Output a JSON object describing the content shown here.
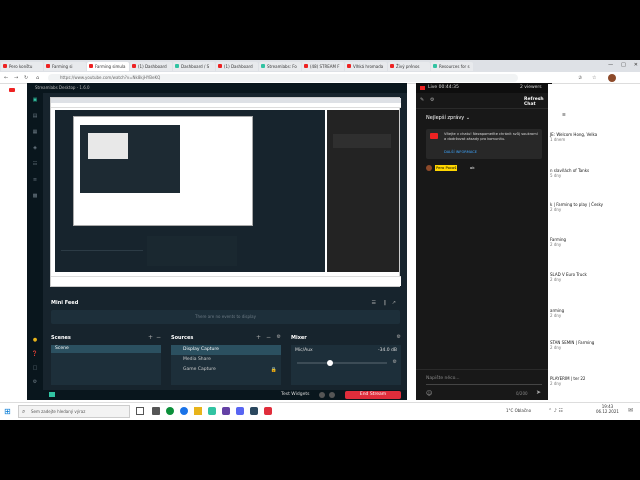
{
  "browser": {
    "tabs": [
      "Pero kon&#x161;tu",
      "Farming si",
      "Farming simula",
      "(1) Dashboard",
      "Dashboard / S",
      "(1) Dashboard",
      "Streamlabs: Fo",
      "(48) STREAM F",
      "Vlhk&#xe1; hromada",
      "&#x17d;iv&#xfd; pr&#xe9;nos",
      "Resources for s"
    ],
    "address": "https://www.youtube.com/watch?v=Nk8kjHYBeKQ"
  },
  "slobs": {
    "title": "Streamlabs Desktop - 1.6.0",
    "mini_feed_title": "Mini Feed",
    "mini_feed_empty": "There are no events to display",
    "scenes_title": "Scenes",
    "scene_item": "Scene",
    "sources_title": "Sources",
    "sources": [
      "Display Capture",
      "Media Share",
      "Game Capture"
    ],
    "mixer_title": "Mixer",
    "mixer_channel": "Mic/Aux",
    "mixer_db": "-34.0 dB",
    "test_widgets": "Test Widgets",
    "end_stream": "End Stream"
  },
  "chat": {
    "live_time": "Live 00:44:35",
    "viewers": "2 viewers",
    "refresh": "Refresh Chat",
    "filter": "Nejlep&#x161;&#xed; zpr&#xe1;vy",
    "notice": "V&#xed;tejte v chatu! Nezapome&#x148;te chr&#xe1;nit sv&#x16f;j soukrom&#xed; a dodr&#x17e;ovat z&#xe1;sady pro komunitu.",
    "notice_link": "DAL&#x160;&#xcd; INFORMACE",
    "username": "Pero Poco&#x161;",
    "message": "ok",
    "placeholder": "Napi&#x161;te n&#x11b;co...",
    "counter": "0/200"
  },
  "youtube_side": [
    {
      "title": "JE: Welcom Hong, Velka",
      "meta": "1 dnem"
    },
    {
      "title": "n slav&#x148;&#xe1;ch of Tanks",
      "meta": "5 dny"
    },
    {
      "title": "k | Farming to play | &#x10c;esky",
      "meta": "2 dny"
    },
    {
      "title": "Farming",
      "meta": "2 dny"
    },
    {
      "title": "SLAD V Euro Truck",
      "meta": "2 dny"
    },
    {
      "title": "arming",
      "meta": "2 dny"
    },
    {
      "title": "STAN SEMIN | Farming",
      "meta": "2 dny"
    },
    {
      "title": "PLAYERIM | ter 22",
      "meta": "2 dny"
    }
  ],
  "taskbar": {
    "search": "Sem zadejte hledan&#xfd; v&#xfd;raz",
    "weather": "1&#xb0;C Obla&#x10d;no",
    "time": "19:43",
    "date": "06.12.2021"
  }
}
